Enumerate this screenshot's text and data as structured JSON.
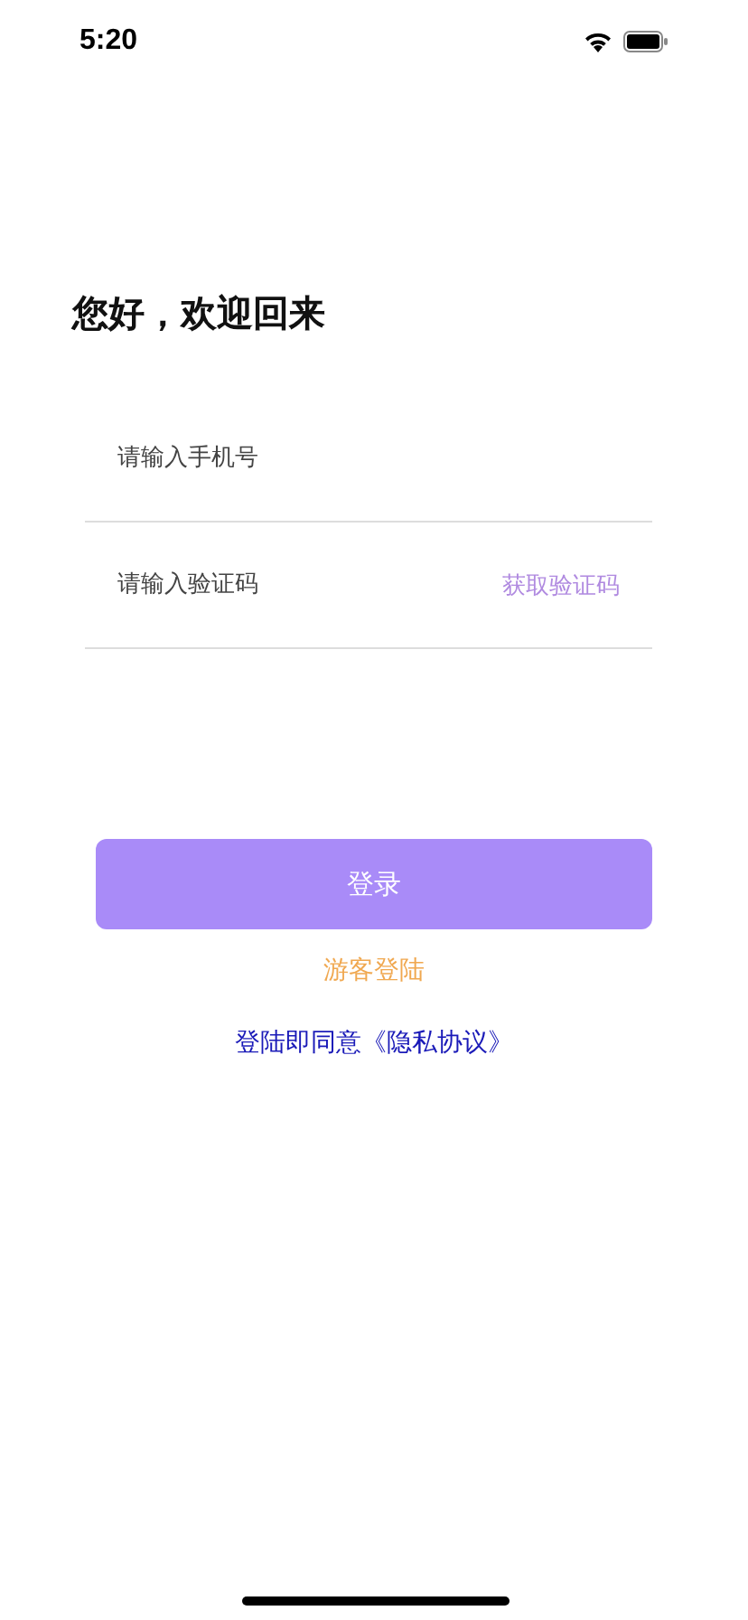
{
  "status_bar": {
    "time": "5:20"
  },
  "greeting": "您好，欢迎回来",
  "phone_field": {
    "placeholder": "请输入手机号"
  },
  "code_field": {
    "placeholder": "请输入验证码",
    "action": "获取验证码"
  },
  "login_button": "登录",
  "guest_link": "游客登陆",
  "agreement": "登陆即同意《隐私协议》"
}
